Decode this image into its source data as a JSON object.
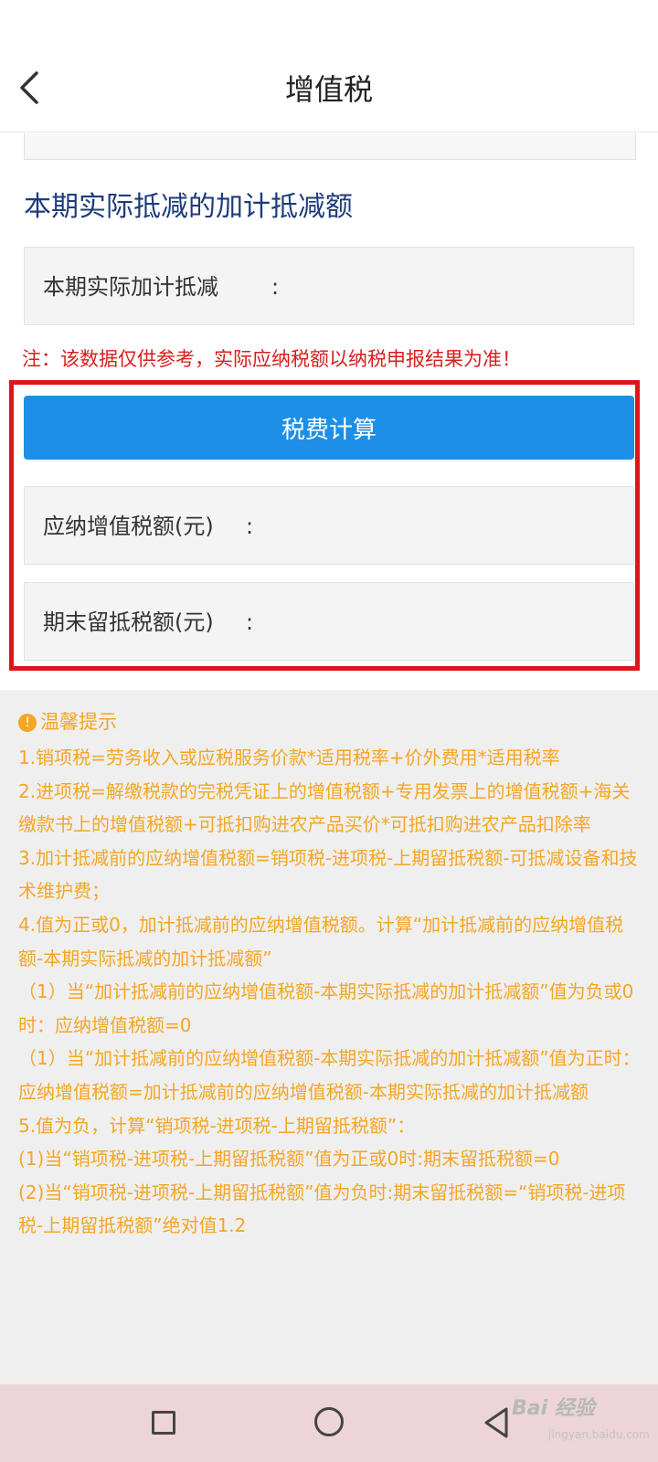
{
  "header": {
    "title": "增值税"
  },
  "section": {
    "title": "本期实际抵减的加计抵减额"
  },
  "fields": {
    "actual_deduction": {
      "label": "本期实际加计抵减",
      "colon": ":"
    },
    "payable_vat": {
      "label": "应纳增值税额(元)",
      "colon": ":"
    },
    "ending_credit": {
      "label": "期末留抵税额(元)",
      "colon": ":"
    }
  },
  "note": "注：该数据仅供参考，实际应纳税额以纳税申报结果为准！",
  "calc_button": "税费计算",
  "tips": {
    "icon": "!",
    "title": "温馨提示",
    "lines": [
      "1.销项税=劳务收入或应税服务价款*适用税率+价外费用*适用税率",
      "2.进项税=解缴税款的完税凭证上的增值税额+专用发票上的增值税额+海关缴款书上的增值税额+可抵扣购进农产品买价*可抵扣购进农产品扣除率",
      "3.加计抵减前的应纳增值税额=销项税-进项税-上期留抵税额-可抵减设备和技术维护费；",
      "4.值为正或0，加计抵减前的应纳增值税额。计算“加计抵减前的应纳增值税额-本期实际抵减的加计抵减额”",
      "（1）当“加计抵减前的应纳增值税额-本期实际抵减的加计抵减额”值为负或0时：应纳增值税额=0",
      "（1）当“加计抵减前的应纳增值税额-本期实际抵减的加计抵减额”值为正时：应纳增值税额=加计抵减前的应纳增值税额-本期实际抵减的加计抵减额",
      "5.值为负，计算“销项税-进项税-上期留抵税额”：",
      "(1)当“销项税-进项税-上期留抵税额”值为正或0时:期末留抵税额=0",
      "(2)当“销项税-进项税-上期留抵税额”值为负时:期末留抵税额=“销项税-进项税-上期留抵税额”绝对值1.2"
    ]
  },
  "watermark": {
    "brand": "Bai 经验",
    "url": "jingyan.baidu.com"
  },
  "colors": {
    "accent": "#1e8fe6",
    "highlight": "#e0151b",
    "note": "#d81e1e",
    "tips": "#f5a623"
  }
}
